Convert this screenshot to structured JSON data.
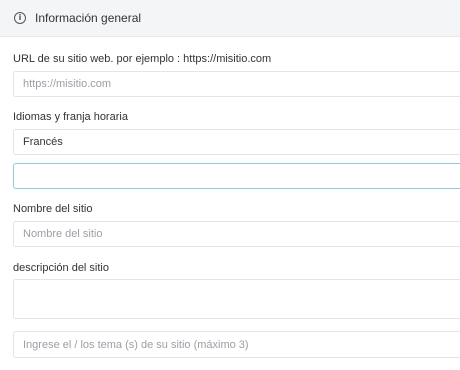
{
  "section": {
    "title": "Información general",
    "icon": "info-circle-icon"
  },
  "url": {
    "label": "URL de su sitio web. por ejemplo : https://misitio.com",
    "placeholder": "https://misitio.com"
  },
  "language": {
    "label": "Idiomas y franja horaria",
    "selected": "Francés",
    "timezone_value": ""
  },
  "site_name": {
    "label": "Nombre del sitio",
    "placeholder": "Nombre del sitio"
  },
  "description": {
    "label": "descripción del sitio",
    "value": ""
  },
  "topics": {
    "placeholder": "Ingrese el / los tema (s) de su sitio (máximo 3)"
  }
}
